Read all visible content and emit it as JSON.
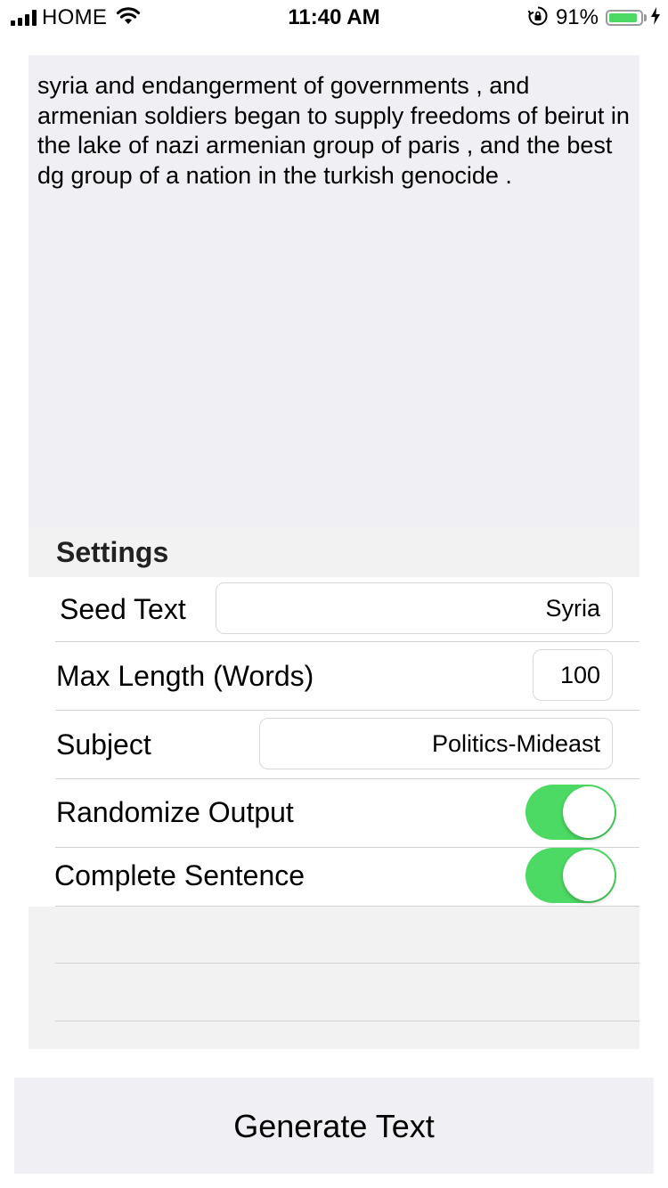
{
  "status_bar": {
    "carrier": "HOME",
    "time": "11:40 AM",
    "battery_percent": "91%",
    "battery_level": 0.91,
    "icons": [
      "signal-icon",
      "wifi-icon",
      "rotation-lock-icon",
      "battery-icon",
      "charging-bolt-icon"
    ]
  },
  "output": {
    "text": "syria and endangerment of governments , and armenian soldiers began to supply freedoms of beirut in the lake of nazi armenian group of paris , and the best dg group of a nation in the turkish genocide ."
  },
  "settings": {
    "header": "Settings",
    "seed_text": {
      "label": "Seed Text",
      "value": "Syria"
    },
    "max_length": {
      "label": "Max Length (Words)",
      "value": "100"
    },
    "subject": {
      "label": "Subject",
      "value": "Politics-Mideast"
    },
    "randomize": {
      "label": "Randomize Output",
      "on": true
    },
    "complete_sentence": {
      "label": "Complete Sentence",
      "on": true
    }
  },
  "actions": {
    "generate_label": "Generate Text"
  },
  "colors": {
    "toggle_on": "#4cd964",
    "panel_bg": "#f2f2f2",
    "output_bg": "#efeff4",
    "button_bg": "#efeff4"
  }
}
